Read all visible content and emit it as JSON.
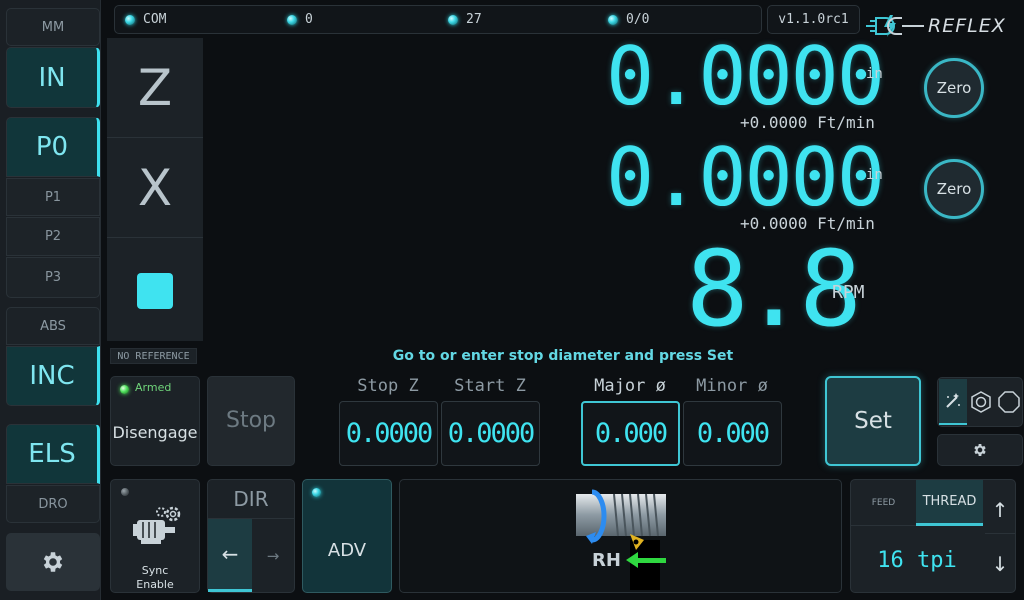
{
  "sidebar": {
    "units_header": "MM",
    "units_selected": "IN",
    "offset_selected": "P0",
    "offsets": [
      "P1",
      "P2",
      "P3"
    ],
    "mode_header": "ABS",
    "mode_selected": "INC",
    "els_label": "ELS",
    "dro_label": "DRO",
    "settings_icon": "gear-icon"
  },
  "status": {
    "com_label": "COM",
    "count_a": "0",
    "count_b": "27",
    "ratio": "0/0",
    "version": "v1.1.0rc1",
    "logo_text": "REFLEX"
  },
  "axes": {
    "z_label": "Z",
    "x_label": "X",
    "z_value": "0.0000",
    "z_unit": "in",
    "z_speed": "+0.0000 Ft/min",
    "x_value": "0.0000",
    "x_unit": "in",
    "x_speed": "+0.0000 Ft/min",
    "rpm_value": "8.8",
    "rpm_unit": "RPM",
    "zero_label": "Zero"
  },
  "reference": "NO REFERENCE",
  "hint": "Go to or enter stop diameter and press Set",
  "controls": {
    "armed_label": "Armed",
    "disengage_label": "Disengage",
    "stop_label": "Stop",
    "stop_z_label": "Stop Z",
    "start_z_label": "Start Z",
    "major_label": "Major ø",
    "minor_label": "Minor ø",
    "stop_z_value": "0.0000",
    "start_z_value": "0.0000",
    "major_value": "0.000",
    "minor_value": "0.000",
    "set_label": "Set"
  },
  "bottom": {
    "sync_label_1": "Sync",
    "sync_label_2": "Enable",
    "dir_label": "DIR",
    "adv_label": "ADV",
    "hand_label": "RH",
    "feed_tab": "FEED",
    "thread_tab": "THREAD",
    "pitch_value": "16 tpi"
  },
  "colors": {
    "accent": "#3fe3f0",
    "background": "#0c0f12",
    "panel": "#1c2227"
  }
}
